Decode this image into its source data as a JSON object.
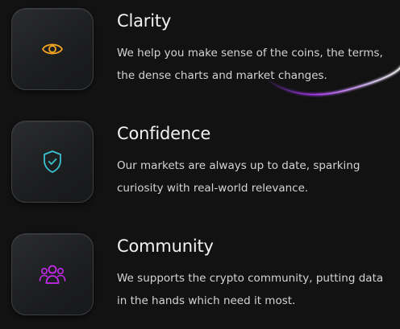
{
  "features": [
    {
      "title": "Clarity",
      "description": "We help you make sense of the coins, the terms, the dense charts and market changes.",
      "icon": "eye-icon",
      "icon_color": "#f5a623"
    },
    {
      "title": "Confidence",
      "description": "Our markets are always up to date, sparking curiosity with real-world relevance.",
      "icon": "shield-check-icon",
      "icon_color": "#39c3cf"
    },
    {
      "title": "Community",
      "description": "We supports the crypto community, putting data in the hands which need it most.",
      "icon": "users-icon",
      "icon_color": "#c22bea"
    }
  ],
  "colors": {
    "background": "#121212",
    "title": "#f2f2f2",
    "text": "#d4d4d4",
    "accent_glow": "#9b3cff"
  }
}
